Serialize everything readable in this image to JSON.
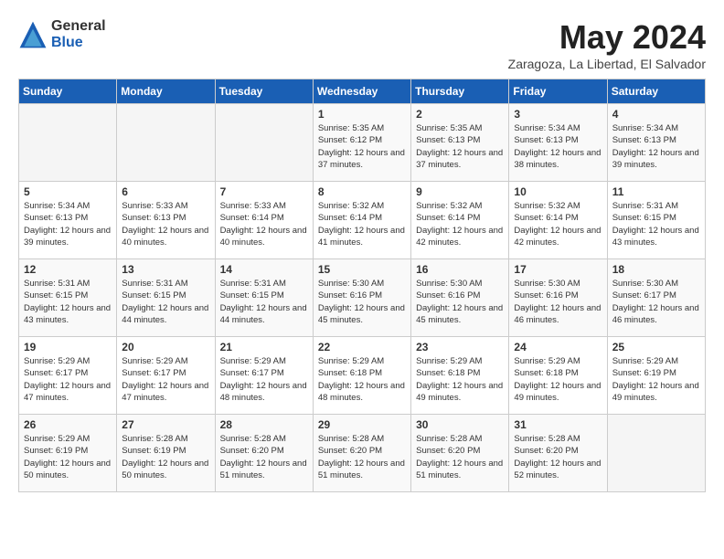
{
  "header": {
    "logo_general": "General",
    "logo_blue": "Blue",
    "month": "May 2024",
    "location": "Zaragoza, La Libertad, El Salvador"
  },
  "weekdays": [
    "Sunday",
    "Monday",
    "Tuesday",
    "Wednesday",
    "Thursday",
    "Friday",
    "Saturday"
  ],
  "weeks": [
    [
      {
        "day": "",
        "sunrise": "",
        "sunset": "",
        "daylight": ""
      },
      {
        "day": "",
        "sunrise": "",
        "sunset": "",
        "daylight": ""
      },
      {
        "day": "",
        "sunrise": "",
        "sunset": "",
        "daylight": ""
      },
      {
        "day": "1",
        "sunrise": "Sunrise: 5:35 AM",
        "sunset": "Sunset: 6:12 PM",
        "daylight": "Daylight: 12 hours and 37 minutes."
      },
      {
        "day": "2",
        "sunrise": "Sunrise: 5:35 AM",
        "sunset": "Sunset: 6:13 PM",
        "daylight": "Daylight: 12 hours and 37 minutes."
      },
      {
        "day": "3",
        "sunrise": "Sunrise: 5:34 AM",
        "sunset": "Sunset: 6:13 PM",
        "daylight": "Daylight: 12 hours and 38 minutes."
      },
      {
        "day": "4",
        "sunrise": "Sunrise: 5:34 AM",
        "sunset": "Sunset: 6:13 PM",
        "daylight": "Daylight: 12 hours and 39 minutes."
      }
    ],
    [
      {
        "day": "5",
        "sunrise": "Sunrise: 5:34 AM",
        "sunset": "Sunset: 6:13 PM",
        "daylight": "Daylight: 12 hours and 39 minutes."
      },
      {
        "day": "6",
        "sunrise": "Sunrise: 5:33 AM",
        "sunset": "Sunset: 6:13 PM",
        "daylight": "Daylight: 12 hours and 40 minutes."
      },
      {
        "day": "7",
        "sunrise": "Sunrise: 5:33 AM",
        "sunset": "Sunset: 6:14 PM",
        "daylight": "Daylight: 12 hours and 40 minutes."
      },
      {
        "day": "8",
        "sunrise": "Sunrise: 5:32 AM",
        "sunset": "Sunset: 6:14 PM",
        "daylight": "Daylight: 12 hours and 41 minutes."
      },
      {
        "day": "9",
        "sunrise": "Sunrise: 5:32 AM",
        "sunset": "Sunset: 6:14 PM",
        "daylight": "Daylight: 12 hours and 42 minutes."
      },
      {
        "day": "10",
        "sunrise": "Sunrise: 5:32 AM",
        "sunset": "Sunset: 6:14 PM",
        "daylight": "Daylight: 12 hours and 42 minutes."
      },
      {
        "day": "11",
        "sunrise": "Sunrise: 5:31 AM",
        "sunset": "Sunset: 6:15 PM",
        "daylight": "Daylight: 12 hours and 43 minutes."
      }
    ],
    [
      {
        "day": "12",
        "sunrise": "Sunrise: 5:31 AM",
        "sunset": "Sunset: 6:15 PM",
        "daylight": "Daylight: 12 hours and 43 minutes."
      },
      {
        "day": "13",
        "sunrise": "Sunrise: 5:31 AM",
        "sunset": "Sunset: 6:15 PM",
        "daylight": "Daylight: 12 hours and 44 minutes."
      },
      {
        "day": "14",
        "sunrise": "Sunrise: 5:31 AM",
        "sunset": "Sunset: 6:15 PM",
        "daylight": "Daylight: 12 hours and 44 minutes."
      },
      {
        "day": "15",
        "sunrise": "Sunrise: 5:30 AM",
        "sunset": "Sunset: 6:16 PM",
        "daylight": "Daylight: 12 hours and 45 minutes."
      },
      {
        "day": "16",
        "sunrise": "Sunrise: 5:30 AM",
        "sunset": "Sunset: 6:16 PM",
        "daylight": "Daylight: 12 hours and 45 minutes."
      },
      {
        "day": "17",
        "sunrise": "Sunrise: 5:30 AM",
        "sunset": "Sunset: 6:16 PM",
        "daylight": "Daylight: 12 hours and 46 minutes."
      },
      {
        "day": "18",
        "sunrise": "Sunrise: 5:30 AM",
        "sunset": "Sunset: 6:17 PM",
        "daylight": "Daylight: 12 hours and 46 minutes."
      }
    ],
    [
      {
        "day": "19",
        "sunrise": "Sunrise: 5:29 AM",
        "sunset": "Sunset: 6:17 PM",
        "daylight": "Daylight: 12 hours and 47 minutes."
      },
      {
        "day": "20",
        "sunrise": "Sunrise: 5:29 AM",
        "sunset": "Sunset: 6:17 PM",
        "daylight": "Daylight: 12 hours and 47 minutes."
      },
      {
        "day": "21",
        "sunrise": "Sunrise: 5:29 AM",
        "sunset": "Sunset: 6:17 PM",
        "daylight": "Daylight: 12 hours and 48 minutes."
      },
      {
        "day": "22",
        "sunrise": "Sunrise: 5:29 AM",
        "sunset": "Sunset: 6:18 PM",
        "daylight": "Daylight: 12 hours and 48 minutes."
      },
      {
        "day": "23",
        "sunrise": "Sunrise: 5:29 AM",
        "sunset": "Sunset: 6:18 PM",
        "daylight": "Daylight: 12 hours and 49 minutes."
      },
      {
        "day": "24",
        "sunrise": "Sunrise: 5:29 AM",
        "sunset": "Sunset: 6:18 PM",
        "daylight": "Daylight: 12 hours and 49 minutes."
      },
      {
        "day": "25",
        "sunrise": "Sunrise: 5:29 AM",
        "sunset": "Sunset: 6:19 PM",
        "daylight": "Daylight: 12 hours and 49 minutes."
      }
    ],
    [
      {
        "day": "26",
        "sunrise": "Sunrise: 5:29 AM",
        "sunset": "Sunset: 6:19 PM",
        "daylight": "Daylight: 12 hours and 50 minutes."
      },
      {
        "day": "27",
        "sunrise": "Sunrise: 5:28 AM",
        "sunset": "Sunset: 6:19 PM",
        "daylight": "Daylight: 12 hours and 50 minutes."
      },
      {
        "day": "28",
        "sunrise": "Sunrise: 5:28 AM",
        "sunset": "Sunset: 6:20 PM",
        "daylight": "Daylight: 12 hours and 51 minutes."
      },
      {
        "day": "29",
        "sunrise": "Sunrise: 5:28 AM",
        "sunset": "Sunset: 6:20 PM",
        "daylight": "Daylight: 12 hours and 51 minutes."
      },
      {
        "day": "30",
        "sunrise": "Sunrise: 5:28 AM",
        "sunset": "Sunset: 6:20 PM",
        "daylight": "Daylight: 12 hours and 51 minutes."
      },
      {
        "day": "31",
        "sunrise": "Sunrise: 5:28 AM",
        "sunset": "Sunset: 6:20 PM",
        "daylight": "Daylight: 12 hours and 52 minutes."
      },
      {
        "day": "",
        "sunrise": "",
        "sunset": "",
        "daylight": ""
      }
    ]
  ]
}
